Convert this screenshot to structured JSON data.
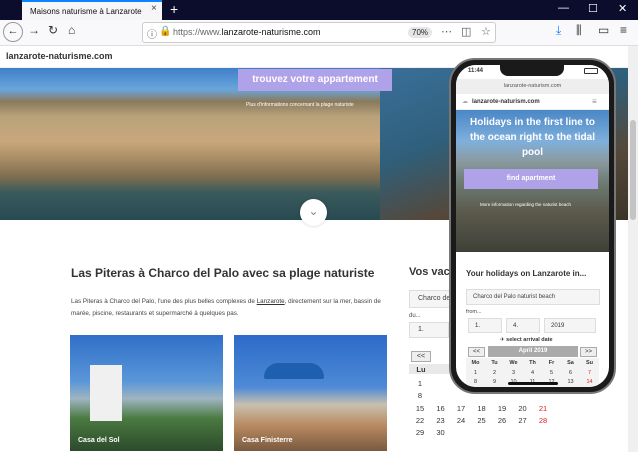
{
  "browser": {
    "tab_title": "Maisons naturisme à Lanzarote",
    "tab_close": "×",
    "new_tab": "+",
    "win_minimize": "—",
    "win_maximize": "☐",
    "win_close": "✕",
    "url_prefix": "https://www.",
    "url_domain": "lanzarote-naturisme.com",
    "zoom": "70%"
  },
  "site": {
    "brand": "lanzarote-naturisme.com",
    "find_button": "trouvez votre appartement",
    "more_link": "Plus d'informations concernant la plage naturiste",
    "heading": "Las Piteras à Charco del Palo avec sa plage naturiste",
    "intro_parts": [
      "Las Piteras à Charco del Palo, l'une des plus belles complexes de ",
      "Lanzarote",
      ", directement sur la mer, bassin de marée, piscine, restaurants et supermarché à quelques pas."
    ],
    "cards": [
      {
        "caption": "Casa del Sol"
      },
      {
        "caption": "Casa Finisterre"
      }
    ],
    "side_title": "Vos vacances",
    "side_select": "Charco del",
    "side_du": "du...",
    "side_day": "1.",
    "side_prev": "<<",
    "side_weekday": "Lu",
    "side_calendar": [
      [
        "",
        "",
        "",
        "",
        "",
        "",
        ""
      ],
      [
        "1",
        "",
        "",
        "",
        "",
        "",
        ""
      ],
      [
        "8",
        "",
        "",
        "",
        "",
        "",
        ""
      ],
      [
        "15",
        "16",
        "17",
        "18",
        "19",
        "20",
        "21"
      ],
      [
        "22",
        "23",
        "24",
        "25",
        "26",
        "27",
        "28"
      ],
      [
        "29",
        "30",
        "",
        "",
        "",
        "",
        ""
      ]
    ]
  },
  "phone": {
    "time": "11:44",
    "url": "lanzarote-naturism.com",
    "brand": "lanzarote-naturism.com",
    "menu_icon": "≡",
    "hero_title": "Holidays in the first line to the ocean right to the tidal pool",
    "find_button": "find apartment",
    "more_link": "More information regarding the naturist beach",
    "section_title": "Your holidays on Lanzarote in...",
    "beach_select": "Charco del Palo naturist beach",
    "from_label": "from...",
    "day": "1.",
    "month": "4.",
    "year": "2019",
    "arrival_label": "select arrival date",
    "prev": "<<",
    "next": ">>",
    "cal_month": "April 2019",
    "weekdays": [
      "Mo",
      "Tu",
      "We",
      "Th",
      "Fr",
      "Sa",
      "Su"
    ],
    "weeks": [
      [
        "1",
        "2",
        "3",
        "4",
        "5",
        "6",
        "7"
      ],
      [
        "8",
        "9",
        "10",
        "11",
        "12",
        "13",
        "14"
      ]
    ]
  },
  "colors": {
    "accent": "#b0a2e8",
    "tab_accent": "#0a84ff",
    "sunday": "#d22"
  }
}
